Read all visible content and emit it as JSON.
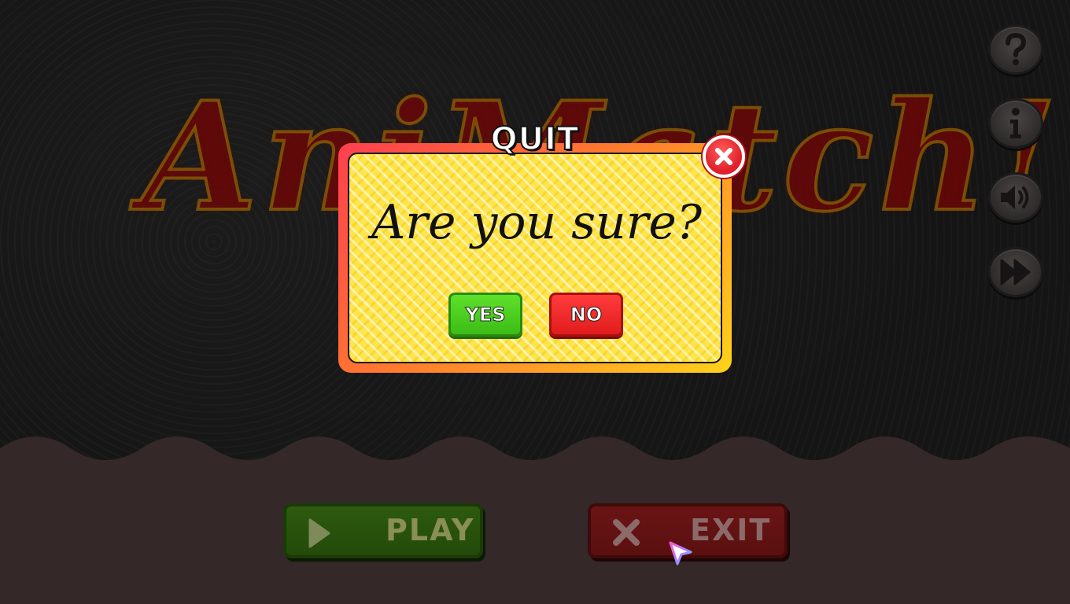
{
  "game": {
    "title": "AniMatch!"
  },
  "side_buttons": [
    {
      "name": "help-button",
      "icon": "question-icon"
    },
    {
      "name": "info-button",
      "icon": "info-icon"
    },
    {
      "name": "sound-button",
      "icon": "speaker-icon"
    },
    {
      "name": "skip-button",
      "icon": "fast-forward-icon"
    }
  ],
  "menu": {
    "play_label": "PLAY",
    "exit_label": "EXIT"
  },
  "dialog": {
    "title": "QUIT",
    "message": "Are you sure?",
    "yes_label": "YES",
    "no_label": "NO"
  },
  "colors": {
    "dialog_border_start": "#ff3f4f",
    "dialog_border_end": "#ffd21a",
    "dialog_fill": "#ffe44a",
    "yes_green": "#3cbc16",
    "no_red": "#e11c1c",
    "close_red": "#e0202a"
  }
}
